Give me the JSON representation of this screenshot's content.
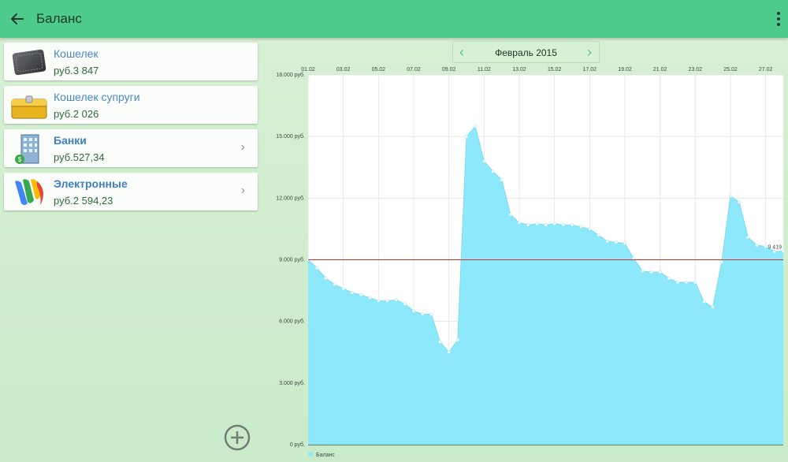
{
  "appbar": {
    "title": "Баланс"
  },
  "accounts": [
    {
      "name": "Кошелек",
      "amount": "руб.3 847",
      "icon": "wallet-icon",
      "bold": false,
      "has_chevron": false
    },
    {
      "name": "Кошелек супруги",
      "amount": "руб.2 026",
      "icon": "purse-icon",
      "bold": false,
      "has_chevron": false
    },
    {
      "name": "Банки",
      "amount": "руб.527,34",
      "icon": "bank-building-icon",
      "bold": true,
      "has_chevron": true
    },
    {
      "name": "Электронные",
      "amount": "руб.2 594,23",
      "icon": "google-wallet-icon",
      "bold": true,
      "has_chevron": true
    }
  ],
  "month_nav": {
    "label": "Февраль 2015",
    "prev": "‹",
    "next": "›"
  },
  "colors": {
    "appbar": "#4ccb8a",
    "area": "#8ce8fa",
    "threshold": "#d0302a"
  },
  "chart_data": {
    "type": "area",
    "x_tick_labels": [
      "01.02",
      "03.02",
      "05.02",
      "07.02",
      "09.02",
      "11.02",
      "13.02",
      "15.02",
      "17.02",
      "19.02",
      "21.02",
      "23.02",
      "25.02",
      "27.02"
    ],
    "y_tick_labels": [
      "18.000 руб.",
      "15.000 руб.",
      "12.000 руб.",
      "9.000 руб.",
      "6.000 руб.",
      "3.000 руб.",
      "0 руб."
    ],
    "ylim": [
      0,
      18000
    ],
    "series": [
      {
        "name": "Баланс",
        "x": [
          1,
          1.5,
          2,
          2.5,
          3,
          3.5,
          4,
          4.5,
          5,
          5.5,
          6,
          6.5,
          7,
          7.5,
          8,
          8.5,
          9,
          9.5,
          10,
          10.5,
          11,
          11.5,
          12,
          12.5,
          13,
          13.5,
          14,
          14.5,
          15,
          15.5,
          16,
          16.5,
          17,
          17.5,
          18,
          18.5,
          19,
          19.5,
          20,
          20.5,
          21,
          21.5,
          22,
          22.5,
          23,
          23.5,
          24,
          24.5,
          25,
          25.5,
          26,
          26.5,
          27,
          27.5,
          28
        ],
        "values": [
          9000,
          8600,
          8100,
          7800,
          7600,
          7400,
          7300,
          7150,
          7000,
          7000,
          7050,
          6850,
          6500,
          6350,
          6350,
          5000,
          4500,
          5100,
          15000,
          15500,
          13800,
          13300,
          12900,
          11200,
          10800,
          10700,
          10750,
          10700,
          10750,
          10700,
          10700,
          10600,
          10500,
          10200,
          9900,
          9850,
          9800,
          9050,
          8450,
          8400,
          8400,
          8100,
          7900,
          7900,
          7900,
          6950,
          6700,
          8900,
          12100,
          11800,
          10100,
          9700,
          9650,
          9400,
          9419
        ]
      }
    ],
    "threshold": 9000,
    "last_value_label": "9 419",
    "legend": "Баланс",
    "legend_position": "bottom-left",
    "grid": true
  }
}
